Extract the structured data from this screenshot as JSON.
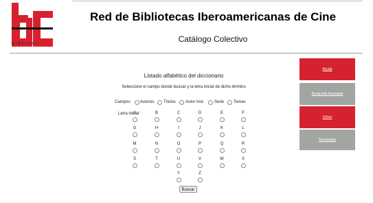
{
  "header": {
    "logo_caption": "BIBLIOCI",
    "title": "Red de Bibliotecas Iberoamericanas de Cine",
    "subtitle": "Catálogo Colectivo"
  },
  "main": {
    "heading": "Listado alfabético del diccionario",
    "instructions": "Seleccione el campo donde buscar y la letra inicial de dicho término",
    "campos_label": "Campos:",
    "campos": [
      "Autores",
      "Títulos",
      "Autor Inst.",
      "Serie",
      "Temas"
    ],
    "letra_label": "Letra inicial :",
    "letters": [
      "A",
      "B",
      "C",
      "D",
      "E",
      "F",
      "G",
      "H",
      "I",
      "J",
      "K",
      "L",
      "M",
      "N",
      "O",
      "P",
      "Q",
      "R",
      "S",
      "T",
      "U",
      "V",
      "W",
      "X",
      "Y",
      "Z"
    ],
    "search_button": "Buscar"
  },
  "sidebar": {
    "items": [
      {
        "label": "Ayuda",
        "color": "red"
      },
      {
        "label": "Busqueda Avanzada",
        "color": "grey"
      },
      {
        "label": "Volver",
        "color": "red"
      },
      {
        "label": "Novedades",
        "color": "grey"
      }
    ]
  },
  "colors": {
    "red": "#d6222e",
    "grey": "#a2a6a3"
  }
}
